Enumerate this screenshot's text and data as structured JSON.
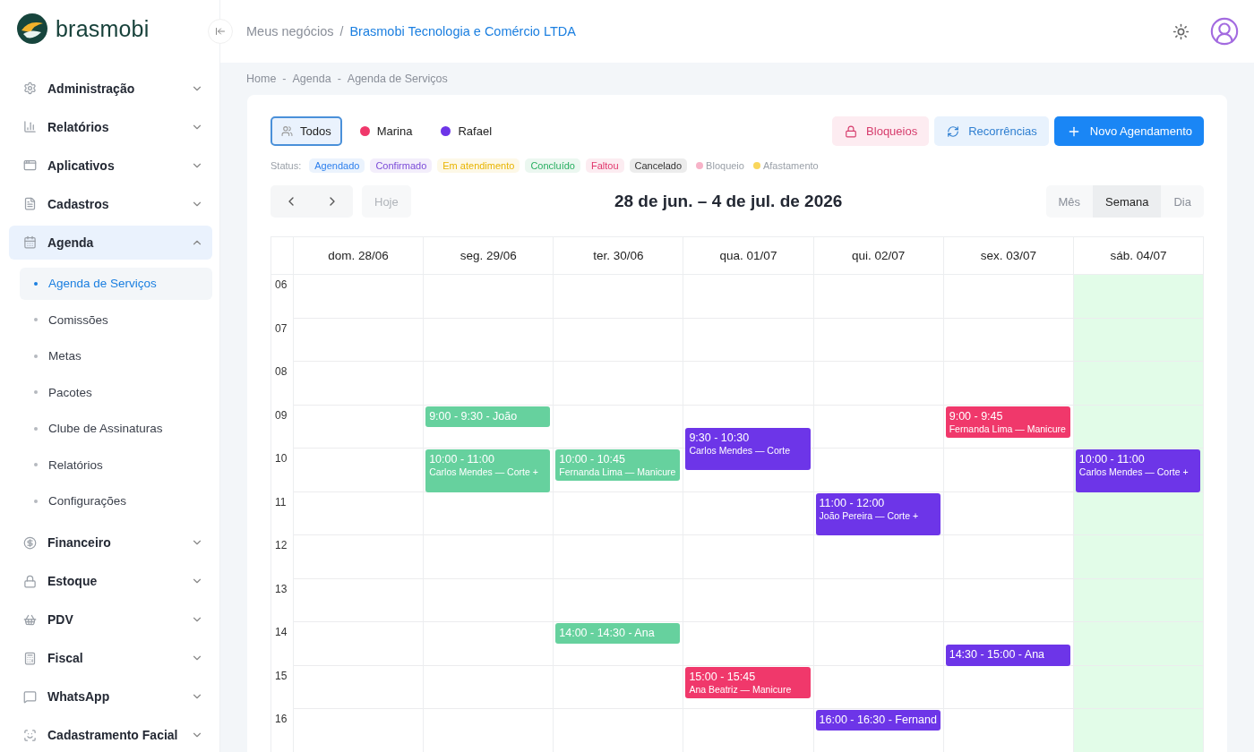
{
  "brand": {
    "name": "brasmobi"
  },
  "sidebar": {
    "items": [
      {
        "label": "Administração",
        "expanded": false
      },
      {
        "label": "Relatórios",
        "expanded": false
      },
      {
        "label": "Aplicativos",
        "expanded": false
      },
      {
        "label": "Cadastros",
        "expanded": false
      },
      {
        "label": "Agenda",
        "expanded": true,
        "children": [
          {
            "label": "Agenda de Serviços",
            "selected": true
          },
          {
            "label": "Comissões",
            "selected": false
          },
          {
            "label": "Metas",
            "selected": false
          },
          {
            "label": "Pacotes",
            "selected": false
          },
          {
            "label": "Clube de Assinaturas",
            "selected": false
          },
          {
            "label": "Relatórios",
            "selected": false
          },
          {
            "label": "Configurações",
            "selected": false
          }
        ]
      },
      {
        "label": "Financeiro",
        "expanded": false
      },
      {
        "label": "Estoque",
        "expanded": false
      },
      {
        "label": "PDV",
        "expanded": false
      },
      {
        "label": "Fiscal",
        "expanded": false
      },
      {
        "label": "WhatsApp",
        "expanded": false
      },
      {
        "label": "Cadastramento Facial",
        "expanded": false
      }
    ]
  },
  "topbar": {
    "breadcrumb": [
      "Meus negócios",
      "Brasmobi Tecnologia e Comércio LTDA"
    ],
    "separator": "/"
  },
  "breadcrumbs": {
    "items": [
      "Home",
      "Agenda",
      "Agenda de Serviços"
    ],
    "separator": "-"
  },
  "professionals": [
    {
      "label": "Todos",
      "selected": true,
      "kind": "all"
    },
    {
      "label": "Marina",
      "selected": false,
      "kind": "person",
      "color": "#f0386b"
    },
    {
      "label": "Rafael",
      "selected": false,
      "kind": "person",
      "color": "#6d35e8"
    }
  ],
  "actions": [
    {
      "label": "Bloqueios",
      "kind": "block"
    },
    {
      "label": "Recorrências",
      "kind": "recurrence"
    },
    {
      "label": "Novo Agendamento",
      "kind": "primary"
    }
  ],
  "status_legend": {
    "label": "Status:",
    "chips": [
      {
        "label": "Agendado",
        "color": "#2f80ed"
      },
      {
        "label": "Confirmado",
        "color": "#7b4bd8"
      },
      {
        "label": "Em atendimento",
        "color": "#e8b400"
      },
      {
        "label": "Concluído",
        "color": "#27ae60"
      },
      {
        "label": "Faltou",
        "color": "#e0356b"
      },
      {
        "label": "Cancelado",
        "color": "#333333"
      }
    ],
    "markers": [
      {
        "label": "Bloqueio",
        "color": "#f7b3c8"
      },
      {
        "label": "Afastamento",
        "color": "#f9d65c"
      }
    ]
  },
  "toolbar": {
    "today": {
      "label": "Hoje",
      "disabled": true
    },
    "range": "28 de jun. – 4 de jul. de 2026",
    "views": [
      {
        "label": "Mês",
        "selected": false
      },
      {
        "label": "Semana",
        "selected": true
      },
      {
        "label": "Dia",
        "selected": false
      }
    ]
  },
  "calendar": {
    "hours": [
      "06",
      "07",
      "08",
      "09",
      "10",
      "11",
      "12",
      "13",
      "14",
      "15",
      "16"
    ],
    "days": [
      {
        "label": "dom. 28/06",
        "today": false
      },
      {
        "label": "seg. 29/06",
        "today": false,
        "events": [
          {
            "title": "9:00 - 9:30 - João",
            "color": "#66d19e"
          },
          {
            "title": "10:00 - 11:00",
            "detail": "Carlos Mendes — Corte +",
            "color": "#66d19e"
          }
        ]
      },
      {
        "label": "ter. 30/06",
        "today": false,
        "events": [
          {
            "title": "10:00 - 10:45",
            "detail": "Fernanda Lima — Manicure",
            "color": "#66d19e"
          },
          {
            "title": "14:00 - 14:30 - Ana",
            "color": "#66d19e"
          }
        ]
      },
      {
        "label": "qua. 01/07",
        "today": false,
        "events": [
          {
            "title": "9:30 - 10:30",
            "detail": "Carlos Mendes — Corte",
            "color": "#6d35e8"
          },
          {
            "title": "15:00 - 15:45",
            "detail": "Ana Beatriz — Manicure",
            "color": "#f0386b"
          }
        ]
      },
      {
        "label": "qui. 02/07",
        "today": false,
        "events": [
          {
            "title": "11:00 - 12:00",
            "detail": "João Pereira — Corte +",
            "color": "#6d35e8"
          },
          {
            "title": "16:00 - 16:30 - Fernand",
            "color": "#6d35e8"
          }
        ]
      },
      {
        "label": "sex. 03/07",
        "today": false,
        "events": [
          {
            "title": "9:00 - 9:45",
            "detail": "Fernanda Lima — Manicure",
            "color": "#f0386b"
          },
          {
            "title": "14:30 - 15:00 - Ana",
            "color": "#6d35e8"
          }
        ]
      },
      {
        "label": "sáb. 04/07",
        "today": true,
        "events": [
          {
            "title": "10:00 - 11:00",
            "detail": "Carlos Mendes — Corte +",
            "color": "#6d35e8"
          }
        ]
      }
    ]
  }
}
